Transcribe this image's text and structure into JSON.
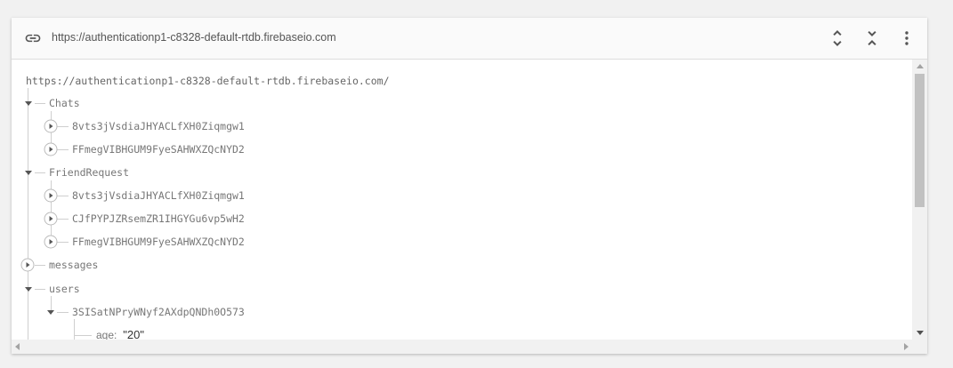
{
  "header": {
    "url": "https://authenticationp1-c8328-default-rtdb.firebaseio.com",
    "icons": [
      "link-icon",
      "expand-all-icon",
      "collapse-all-icon",
      "more-vert-icon"
    ]
  },
  "tree": {
    "root_url": "https://authenticationp1-c8328-default-rtdb.firebaseio.com/",
    "chats": {
      "label": "Chats",
      "children": [
        "8vts3jVsdiaJHYACLfXH0Ziqmgw1",
        "FFmegVIBHGUM9FyeSAHWXZQcNYD2"
      ]
    },
    "friend_request": {
      "label": "FriendRequest",
      "children": [
        "8vts3jVsdiaJHYACLfXH0Ziqmgw1",
        "CJfPYPJZRsemZR1IHGYGu6vp5wH2",
        "FFmegVIBHGUM9FyeSAHWXZQcNYD2"
      ]
    },
    "messages": {
      "label": "messages"
    },
    "users": {
      "label": "users",
      "child": "3SISatNPryWNyf2AXdpQNDh0O573",
      "leaf_key": "age:",
      "leaf_value": "\"20\""
    }
  }
}
